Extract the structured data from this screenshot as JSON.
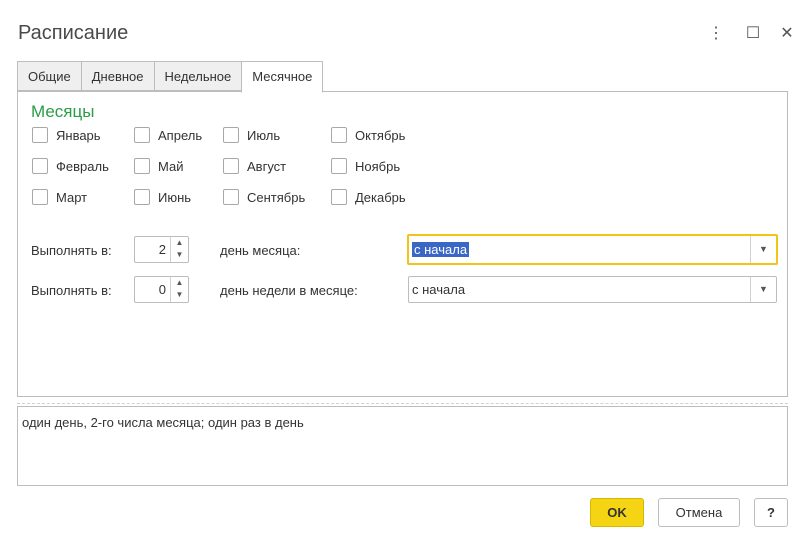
{
  "window": {
    "title": "Расписание",
    "menu_icon": "⋮",
    "maximize_icon": "☐",
    "close_icon": "✕"
  },
  "tabs": [
    {
      "label": "Общие",
      "active": false
    },
    {
      "label": "Дневное",
      "active": false
    },
    {
      "label": "Недельное",
      "active": false
    },
    {
      "label": "Месячное",
      "active": true
    }
  ],
  "months_section": {
    "title": "Месяцы",
    "months": [
      {
        "label": "Январь",
        "checked": false
      },
      {
        "label": "Февраль",
        "checked": false
      },
      {
        "label": "Март",
        "checked": false
      },
      {
        "label": "Апрель",
        "checked": false
      },
      {
        "label": "Май",
        "checked": false
      },
      {
        "label": "Июнь",
        "checked": false
      },
      {
        "label": "Июль",
        "checked": false
      },
      {
        "label": "Август",
        "checked": false
      },
      {
        "label": "Сентябрь",
        "checked": false
      },
      {
        "label": "Октябрь",
        "checked": false
      },
      {
        "label": "Ноябрь",
        "checked": false
      },
      {
        "label": "Декабрь",
        "checked": false
      }
    ]
  },
  "run_rows": [
    {
      "label": "Выполнять в:",
      "value": "2",
      "suffix": "день месяца:",
      "combo_value": "с начала",
      "focused": true
    },
    {
      "label": "Выполнять в:",
      "value": "0",
      "suffix": "день недели в месяце:",
      "combo_value": "с начала",
      "focused": false
    }
  ],
  "summary": "один день, 2-го числа месяца; один раз в день",
  "buttons": {
    "ok": "OK",
    "cancel": "Отмена",
    "help": "?"
  },
  "colors": {
    "accent_green": "#2a9d46",
    "primary_button": "#f5d414",
    "focus_border": "#f0c419",
    "selection": "#3a66c6"
  }
}
